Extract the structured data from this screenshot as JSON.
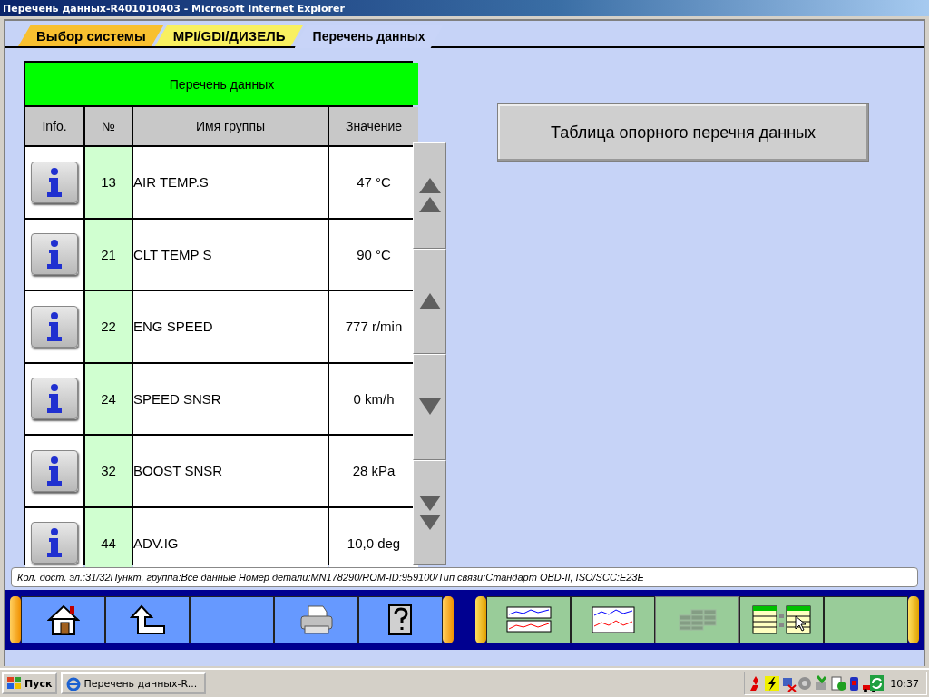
{
  "window": {
    "title": "Перечень данных-R401010403 - Microsoft Internet Explorer"
  },
  "tabs": [
    {
      "label": "Выбор системы",
      "selected": false,
      "color": "#f8c030"
    },
    {
      "label": "MPI/GDI/ДИЗЕЛЬ",
      "selected": false,
      "color": "#f8f060"
    },
    {
      "label": "Перечень данных",
      "selected": true,
      "color": "#c8d4f8"
    }
  ],
  "table": {
    "title": "Перечень данных",
    "columns": [
      "Info.",
      "№",
      "Имя группы",
      "Значение"
    ],
    "rows": [
      {
        "number": "13",
        "name": "AIR TEMP.S",
        "value": "47 °C"
      },
      {
        "number": "21",
        "name": "CLT TEMP S",
        "value": "90 °C"
      },
      {
        "number": "22",
        "name": "ENG SPEED",
        "value": "777 r/min"
      },
      {
        "number": "24",
        "name": "SPEED SNSR",
        "value": "0 km/h"
      },
      {
        "number": "32",
        "name": "BOOST SNSR",
        "value": "28 kPa"
      },
      {
        "number": "44",
        "name": "ADV.IG",
        "value": "10,0 deg"
      }
    ]
  },
  "reference_button": {
    "label": "Таблица опорного перечня данных"
  },
  "status_bar": {
    "text": "Кол. дост. эл.:31/32Пункт, группа:Все данные Номер детали:MN178290/ROM-ID:959100/Тип связи:Стандарт OBD-II, ISO/SCC:E23E"
  },
  "toolbar": {
    "left_buttons": [
      {
        "kind": "home",
        "disabled": false
      },
      {
        "kind": "back",
        "disabled": false
      },
      {
        "kind": "blank",
        "disabled": false
      },
      {
        "kind": "print",
        "disabled": false
      },
      {
        "kind": "help",
        "disabled": false
      }
    ],
    "right_buttons": [
      {
        "kind": "dual-graph",
        "disabled": false
      },
      {
        "kind": "graph",
        "disabled": false
      },
      {
        "kind": "table",
        "disabled": true
      },
      {
        "kind": "compare",
        "disabled": false
      },
      {
        "kind": "blank",
        "disabled": false
      }
    ]
  },
  "taskbar": {
    "start": "Пуск",
    "task": "Перечень данных-R...",
    "clock": "10:37"
  }
}
